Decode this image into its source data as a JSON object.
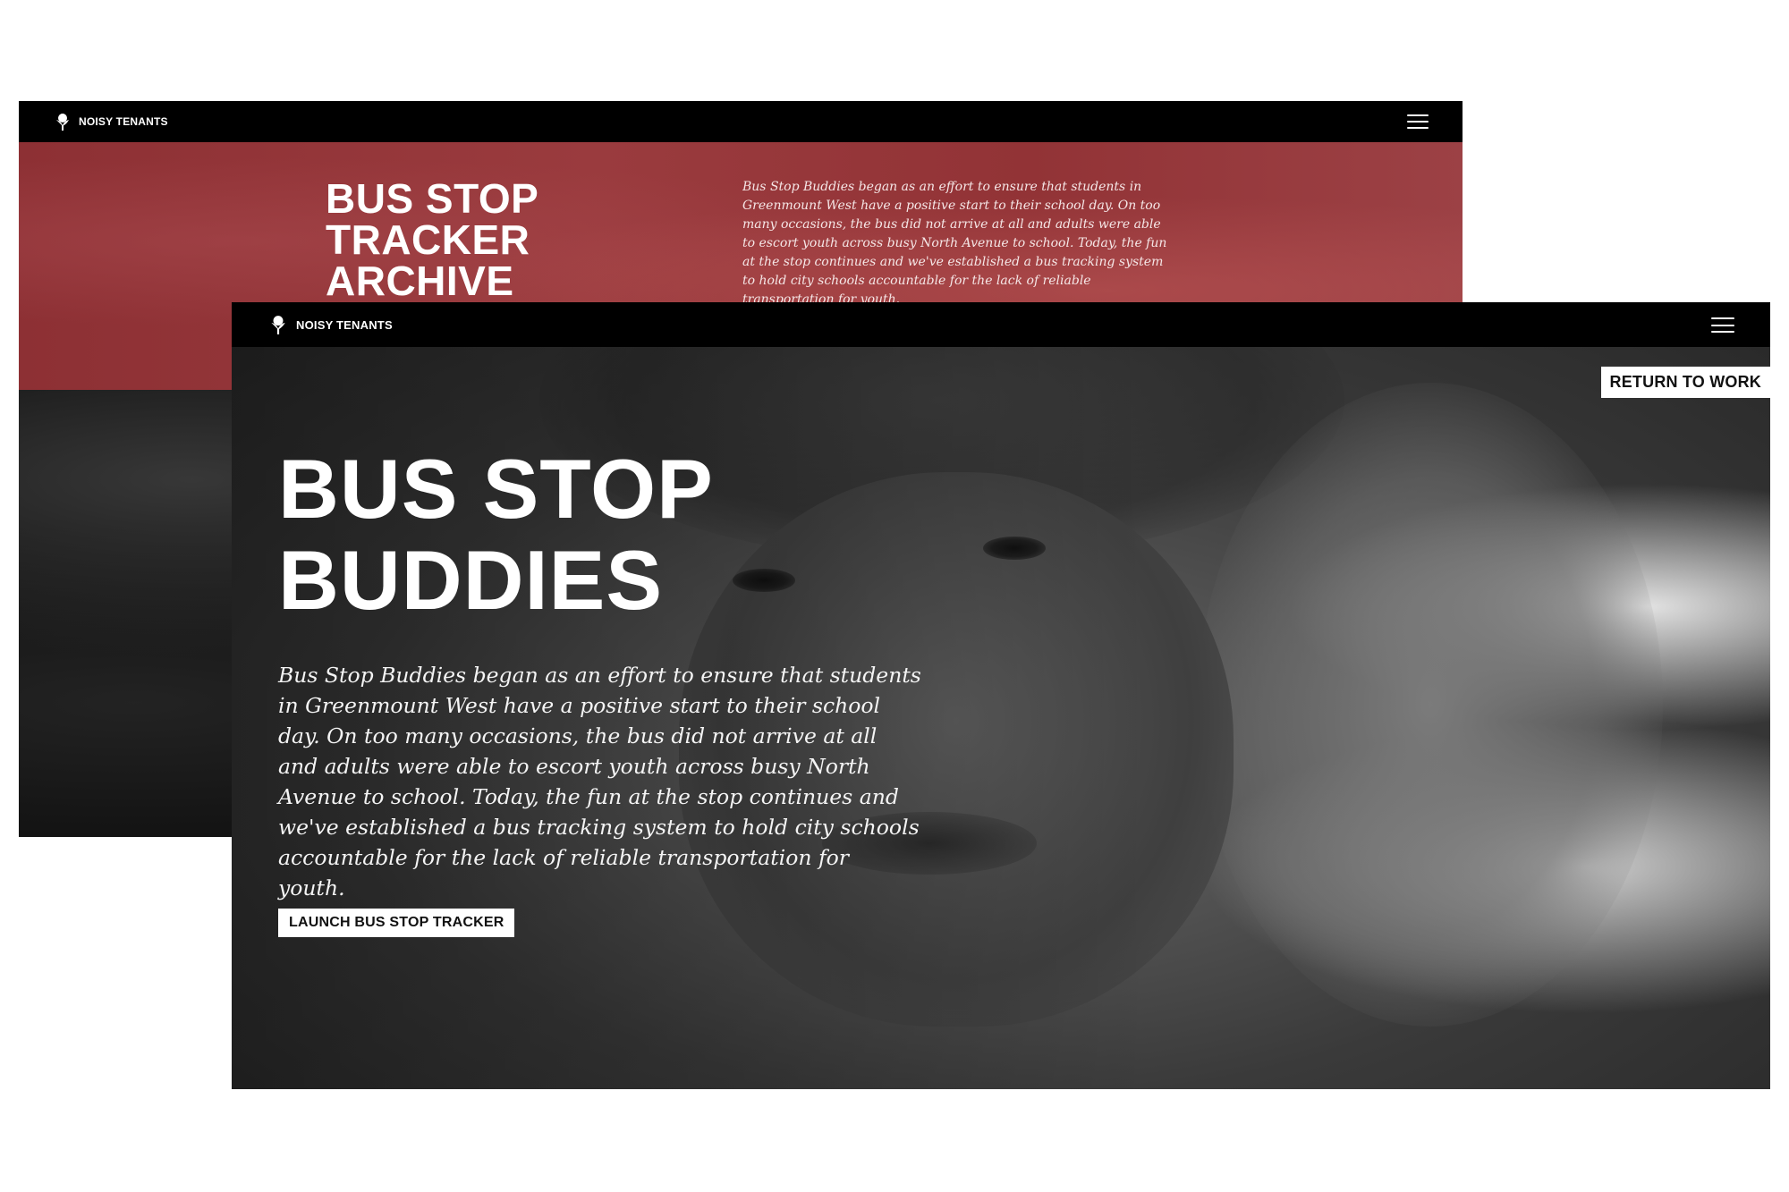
{
  "archive_window": {
    "brand": {
      "name": "NOISY TENANTS",
      "icon": "bird-logo-icon"
    },
    "menu_icon": "hamburger-menu-icon",
    "title": "BUS STOP\nTRACKER\nARCHIVE",
    "description": "Bus Stop Buddies began as an effort to ensure that students in Greenmount West have a positive start to their school day. On too many occasions, the bus did not arrive at all and adults were able to escort youth across busy North Avenue to school. Today, the fun at the stop continues and we've established a bus tracking system to hold city schools accountable for the lack of reliable transportation for youth.",
    "hero_color": "#963a3d"
  },
  "buddies_window": {
    "brand": {
      "name": "NOISY TENANTS",
      "icon": "bird-logo-icon"
    },
    "menu_icon": "hamburger-menu-icon",
    "return_label": "RETURN TO WORK",
    "title": "BUS STOP\nBUDDIES",
    "description": "Bus Stop Buddies began as an effort to ensure that students in Greenmount West have a positive start to their school day. On too many occasions, the bus did not arrive at all and adults were able to escort youth across busy North Avenue to school. Today, the fun at the stop continues and we've established a bus tracking system to hold city schools accountable for the lack of reliable transportation for youth.",
    "launch_label": "LAUNCH BUS STOP TRACKER"
  }
}
